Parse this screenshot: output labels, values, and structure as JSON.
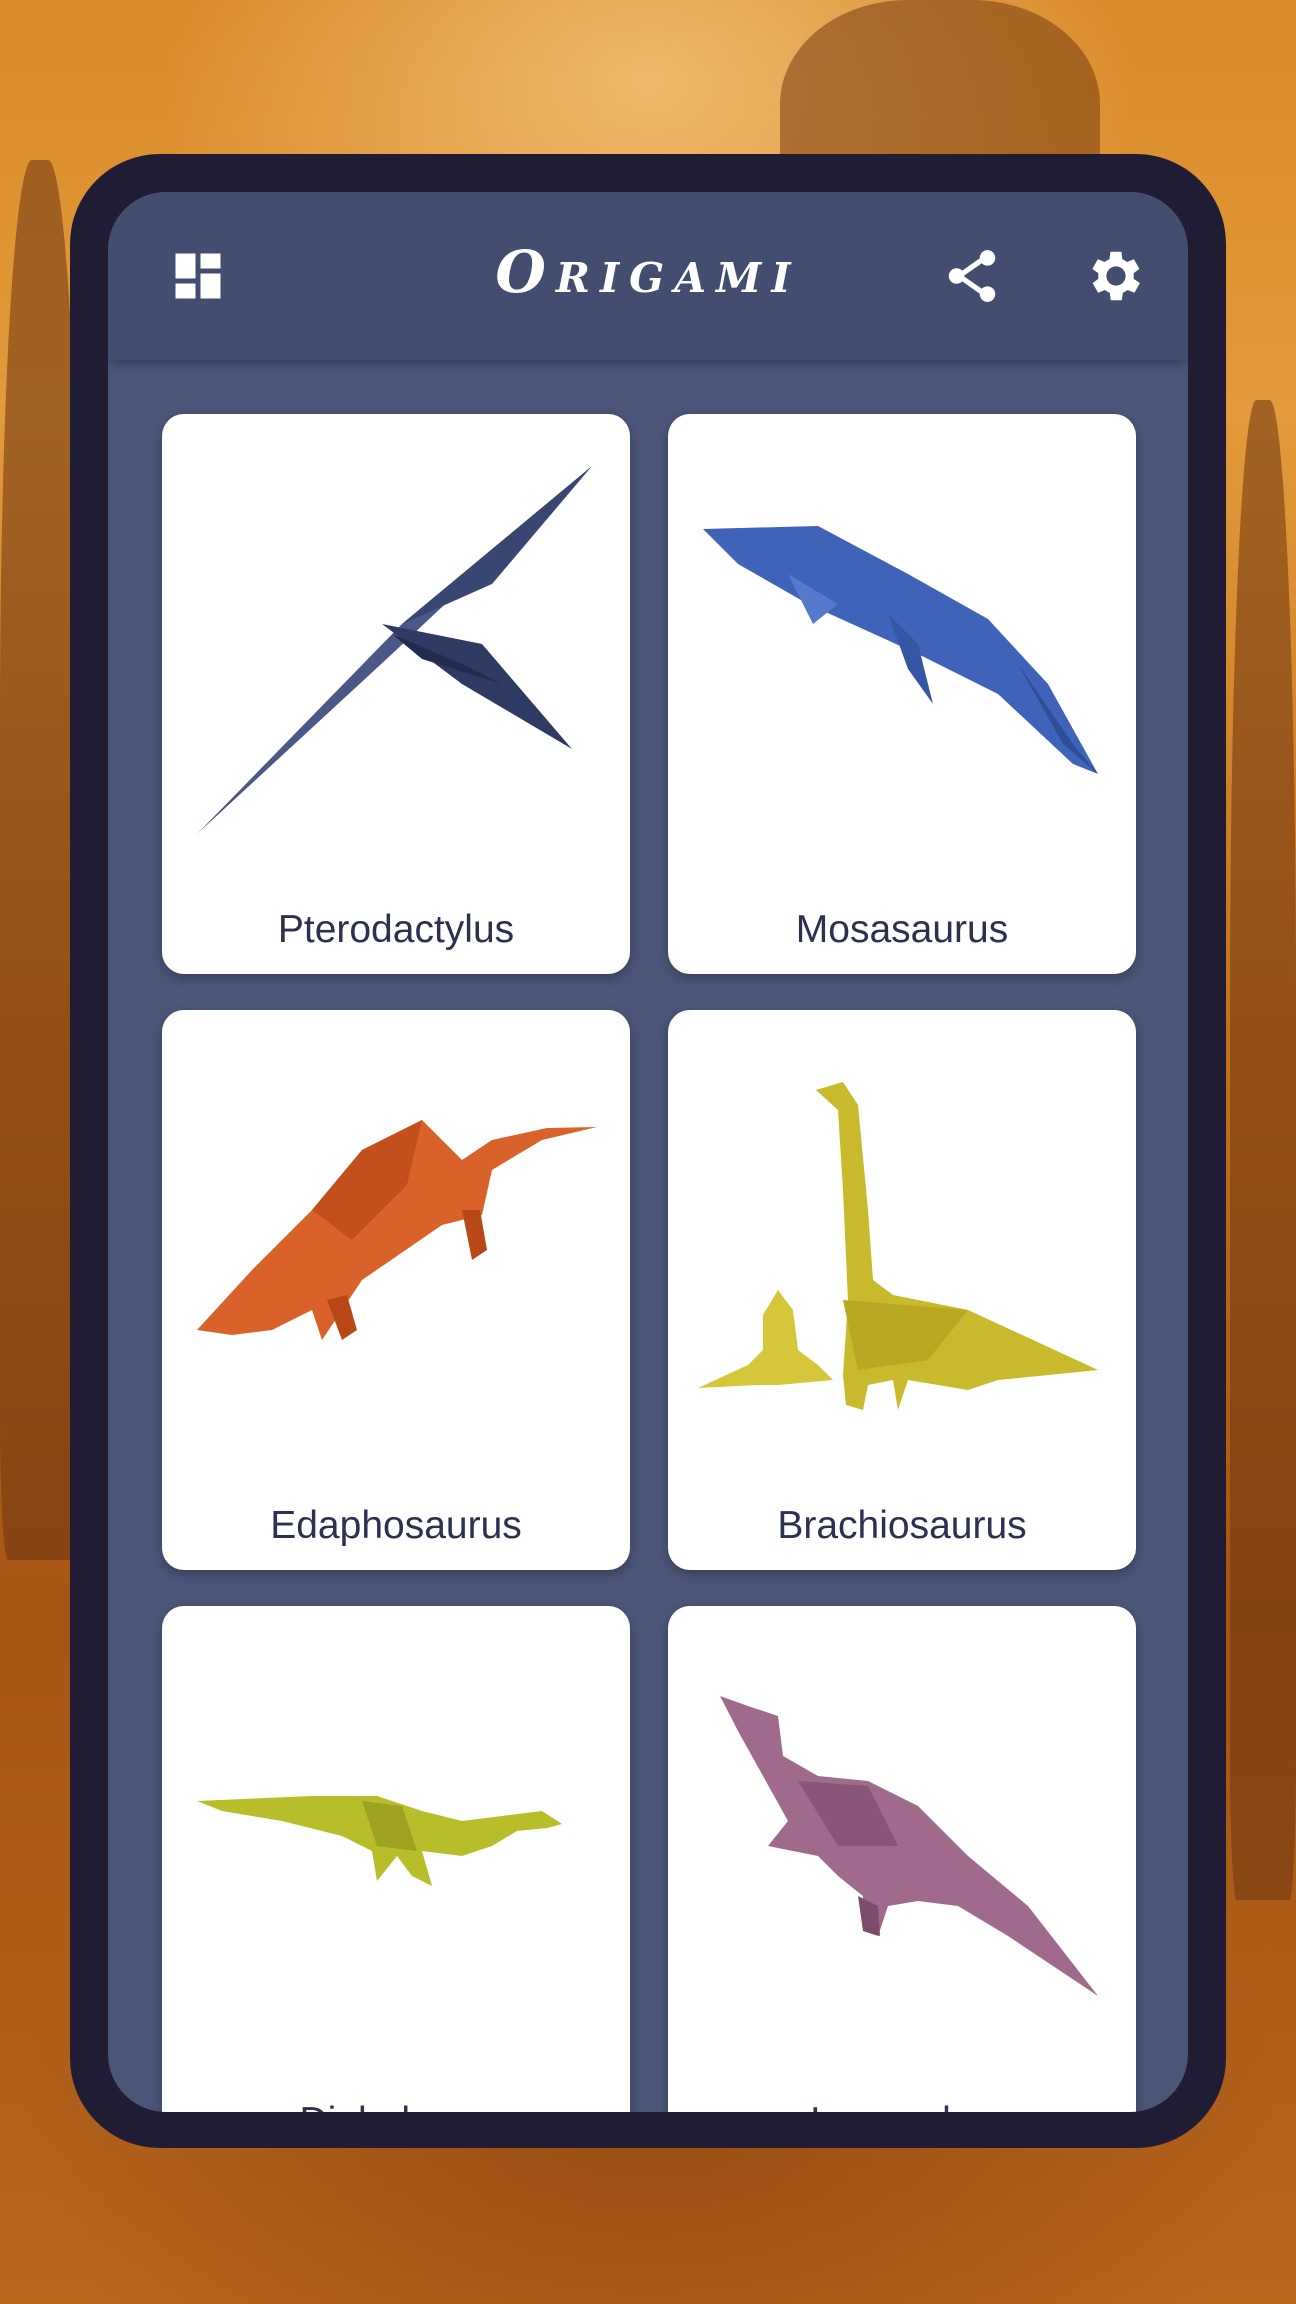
{
  "app": {
    "title": "Origami"
  },
  "toolbar": {
    "left_icon": "dashboard-icon",
    "share_icon": "share-icon",
    "settings_icon": "gear-icon"
  },
  "colors": {
    "appbar": "#424d70",
    "screen": "#4a5578",
    "frame": "#201c33",
    "card": "#ffffff",
    "label": "#2d3150"
  },
  "models": [
    {
      "label": "Pterodactylus",
      "paper_color": "#4a5787"
    },
    {
      "label": "Mosasaurus",
      "paper_color": "#3f63b8"
    },
    {
      "label": "Edaphosaurus",
      "paper_color": "#d9622a"
    },
    {
      "label": "Brachiosaurus",
      "paper_color": "#c9b92d"
    },
    {
      "label": "Diplodocus",
      "paper_color": "#b8bd2a"
    },
    {
      "label": "Iguanodon",
      "paper_color": "#a06a8c"
    }
  ]
}
